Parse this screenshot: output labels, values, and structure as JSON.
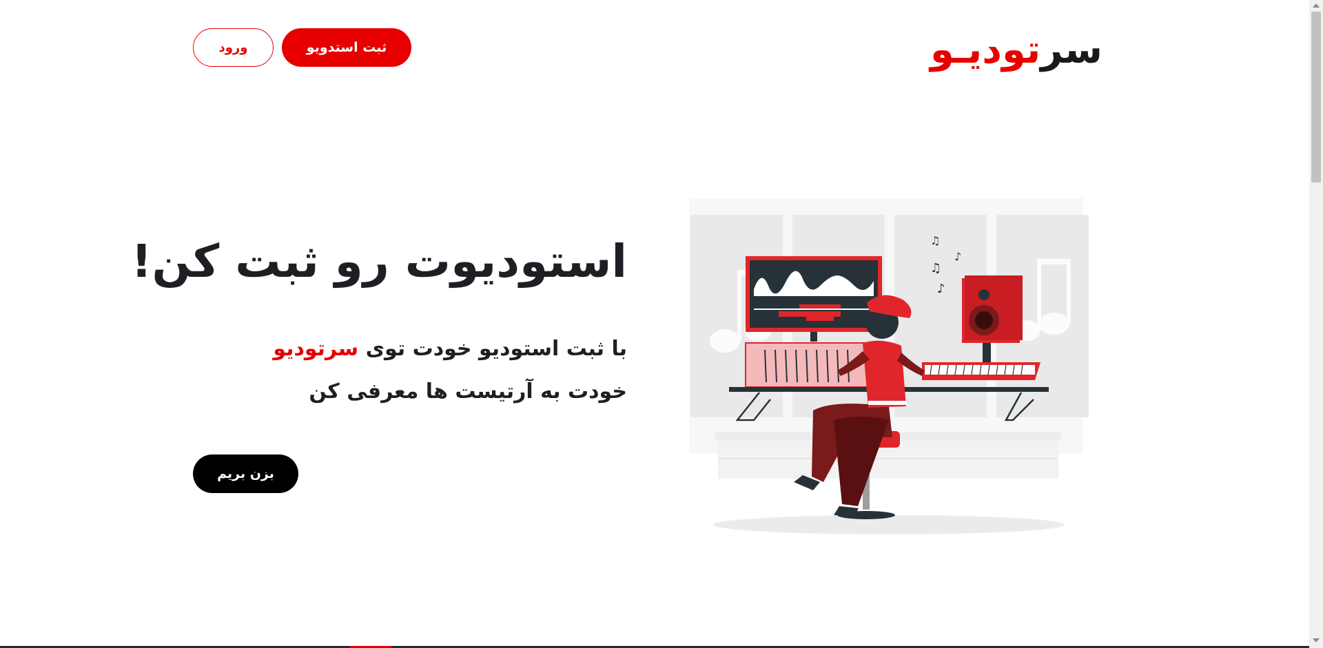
{
  "header": {
    "logo_black": "سر",
    "logo_red": "تودیـو",
    "register_button": "ثبت استدویو",
    "login_button": "ورود"
  },
  "hero": {
    "title": "استودیوت رو ثبت کن!",
    "subtitle_part1": "با ثبت استودیو خودت توی",
    "subtitle_brand": "سرتودیو",
    "subtitle_line2": "خودت به آرتیست ها معرفی کن",
    "cta_button": "بزن بریم"
  },
  "illustration": {
    "icon": "music-studio-illustration",
    "colors": {
      "accent": "#e0262b",
      "dark_red": "#7a1a1a",
      "dark": "#263238",
      "light_gray": "#ebebeb"
    }
  },
  "colors": {
    "brand_red": "#e60000",
    "text_dark": "#1e1f24",
    "cta_black": "#000000"
  }
}
